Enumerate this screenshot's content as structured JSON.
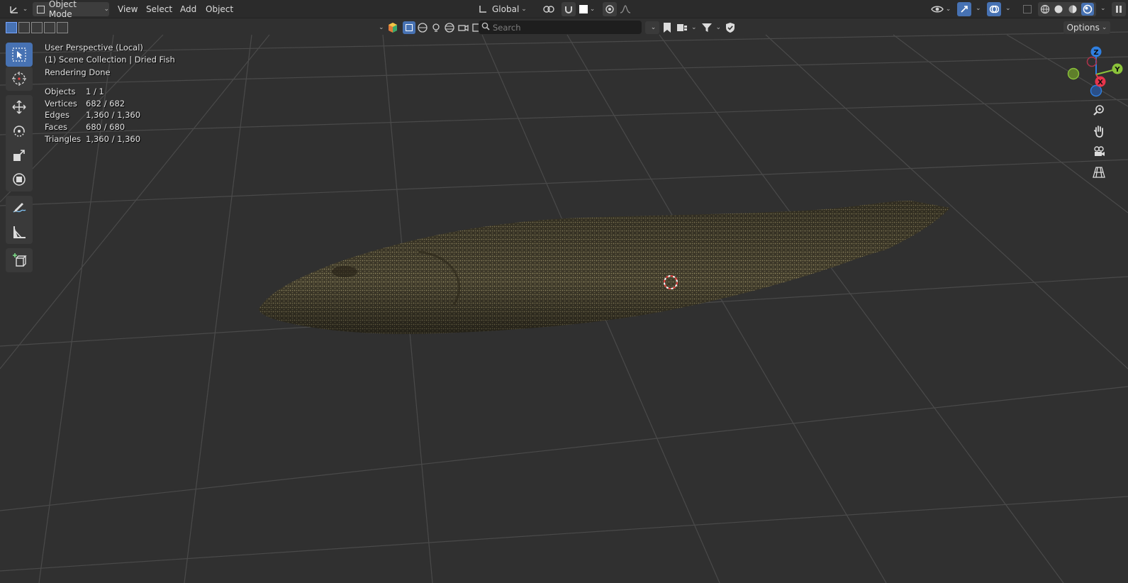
{
  "header": {
    "mode": "Object Mode",
    "menus": [
      "View",
      "Select",
      "Add",
      "Object"
    ],
    "orientation": "Global"
  },
  "toolbar2": {
    "search_placeholder": "Search",
    "options_label": "Options"
  },
  "overlay": {
    "line1": "User Perspective (Local)",
    "line2": "(1) Scene Collection | Dried Fish",
    "line3": "Rendering Done",
    "stats": [
      {
        "label": "Objects",
        "value": "1 / 1"
      },
      {
        "label": "Vertices",
        "value": "682 / 682"
      },
      {
        "label": "Edges",
        "value": "1,360 / 1,360"
      },
      {
        "label": "Faces",
        "value": "680 / 680"
      },
      {
        "label": "Triangles",
        "value": "1,360 / 1,360"
      }
    ]
  },
  "gizmo": {
    "z": "Z",
    "y": "Y",
    "x": "X"
  },
  "colors": {
    "accent": "#4772b3",
    "axis_x": "#e7354c",
    "axis_y": "#8bc33a",
    "axis_z": "#2f7fe0",
    "background": "#303030"
  },
  "tools": [
    "select-box",
    "cursor",
    "move",
    "rotate",
    "scale",
    "transform",
    "annotate",
    "measure",
    "add-cube"
  ]
}
